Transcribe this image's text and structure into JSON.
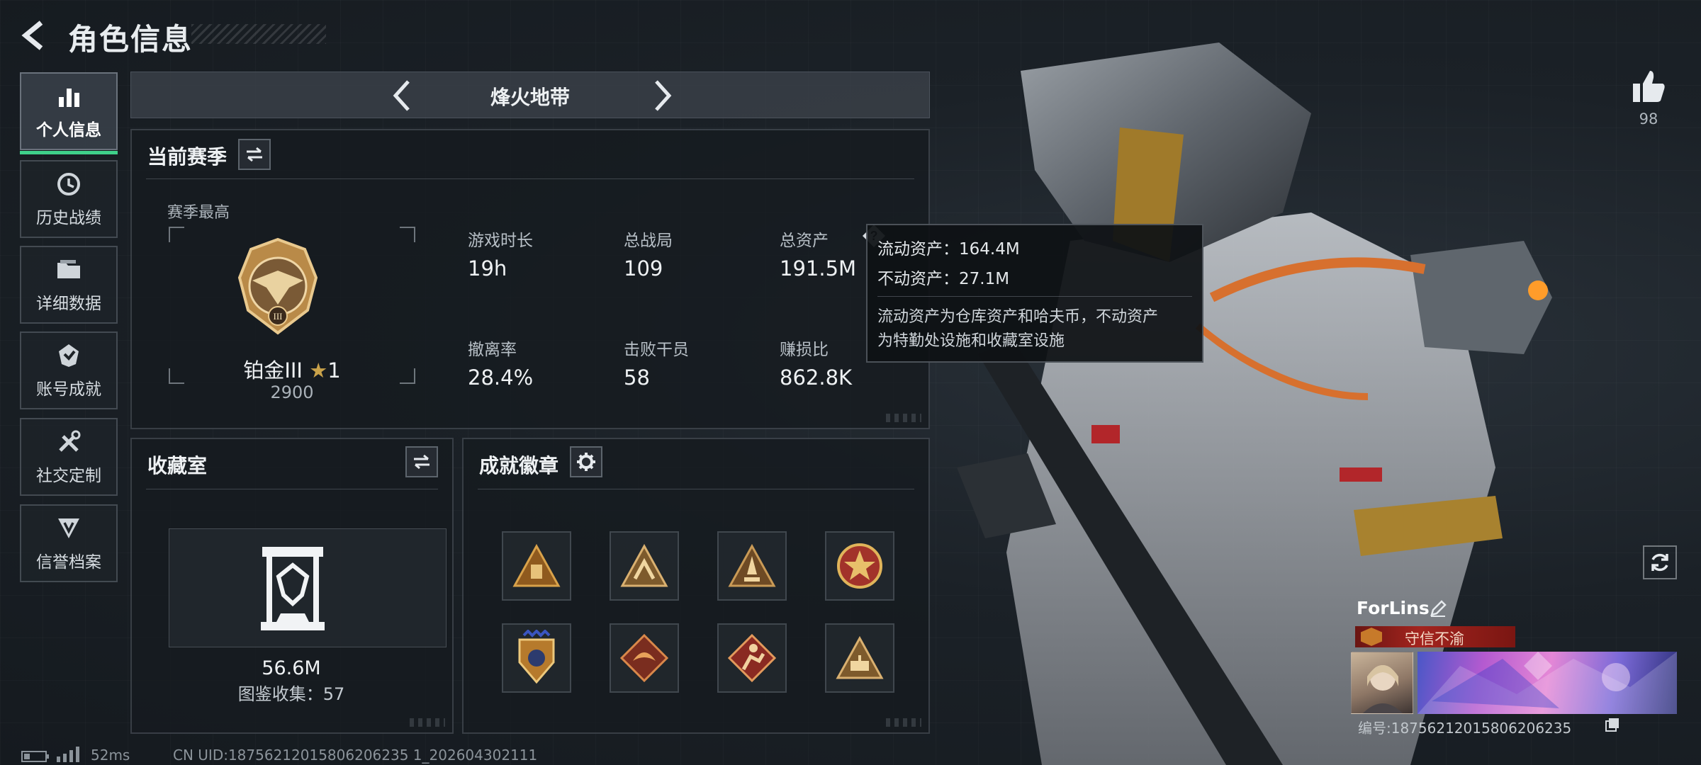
{
  "header": {
    "title": "角色信息"
  },
  "nav": {
    "items": [
      {
        "label": "个人信息",
        "icon": "bar-chart-icon",
        "active": true
      },
      {
        "label": "历史战绩",
        "icon": "history-icon",
        "active": false
      },
      {
        "label": "详细数据",
        "icon": "folder-icon",
        "active": false
      },
      {
        "label": "账号成就",
        "icon": "achievement-icon",
        "active": false
      },
      {
        "label": "社交定制",
        "icon": "tools-icon",
        "active": false
      },
      {
        "label": "信誉档案",
        "icon": "reputation-icon",
        "active": false
      }
    ]
  },
  "mode": {
    "title": "烽火地带"
  },
  "season": {
    "title": "当前赛季",
    "best_label": "赛季最高",
    "rank_name": "铂金III",
    "rank_stars": "1",
    "rank_score": "2900",
    "stats": [
      {
        "label": "游戏时长",
        "value": "19h"
      },
      {
        "label": "总战局",
        "value": "109"
      },
      {
        "label": "总资产",
        "value": "191.5M"
      },
      {
        "label": "撤离率",
        "value": "28.4%"
      },
      {
        "label": "击败干员",
        "value": "58"
      },
      {
        "label": "赚损比",
        "value": "862.8K"
      }
    ]
  },
  "tooltip": {
    "liquid": "流动资产：164.4M",
    "fixed": "不动资产：27.1M",
    "desc_line1": "流动资产为仓库资产和哈夫币，不动资产",
    "desc_line2": "为特勤处设施和收藏室设施"
  },
  "collection": {
    "title": "收藏室",
    "value": "56.6M",
    "count": "图鉴收集：57"
  },
  "badges": {
    "title": "成就徽章",
    "items": [
      {
        "icon": "badge-pyramid-icon"
      },
      {
        "icon": "badge-climber-icon"
      },
      {
        "icon": "badge-rocket-icon"
      },
      {
        "icon": "badge-star-emblem-icon"
      },
      {
        "icon": "badge-shield-icon"
      },
      {
        "icon": "badge-dragon-icon"
      },
      {
        "icon": "badge-runner-icon"
      },
      {
        "icon": "badge-tank-icon"
      }
    ]
  },
  "profile": {
    "likes": "98",
    "name": "ForLins",
    "title": "守信不渝",
    "id": "编号:18756212015806206235"
  },
  "footer": {
    "ping": "52ms",
    "uid": "CN UID:18756212015806206235 1_202604302111"
  },
  "colors": {
    "accent_green": "#3fd08a",
    "gold": "#c9a24a",
    "title_red": "#a3241e"
  }
}
